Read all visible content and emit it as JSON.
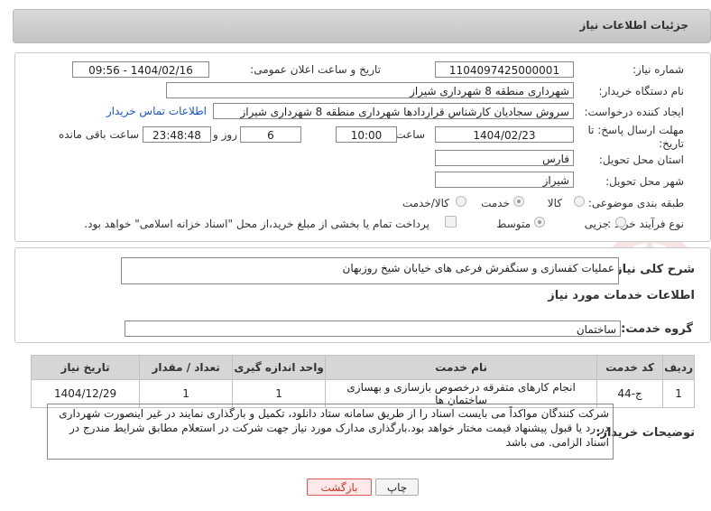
{
  "header": {
    "title": "جزئیات اطلاعات نیاز"
  },
  "form": {
    "need_number_label": "شماره نیاز:",
    "need_number": "1104097425000001",
    "announce_label": "تاریخ و ساعت اعلان عمومی:",
    "announce_value": "1404/02/16 - 09:56",
    "buyer_label": "نام دستگاه خریدار:",
    "buyer": "شهرداری منطقه 8 شهرداری شیراز",
    "creator_label": "ایجاد کننده درخواست:",
    "creator": "سروش سجادیان کارشناس قراردادها شهرداری منطقه 8 شهرداری شیراز",
    "contact_link": "اطلاعات تماس خریدار",
    "deadline_label_1": "مهلت ارسال پاسخ: تا",
    "deadline_label_2": "تاریخ:",
    "deadline_date": "1404/02/23",
    "time_label": "ساعت",
    "deadline_time": "10:00",
    "days_value": "6",
    "days_label": "روز و",
    "remaining_time": "23:48:48",
    "remaining_label": "ساعت باقی مانده",
    "province_label": "استان محل تحویل:",
    "province": "فارس",
    "city_label": "شهر محل تحویل:",
    "city": "شیراز",
    "category_label": "طبقه بندی موضوعی:",
    "category_options": [
      "کالا",
      "خدمت",
      "کالا/خدمت"
    ],
    "category_selected": "خدمت",
    "process_label": "نوع فرآیند خرید :",
    "process_options": [
      "جزیی",
      "متوسط"
    ],
    "process_selected": "متوسط",
    "payment_note": "پرداخت تمام یا بخشی از مبلغ خرید،از محل \"اسناد خزانه اسلامی\" خواهد بود."
  },
  "summary": {
    "label": "شرح کلی نیاز:",
    "text": "عملیات کفسازی و سنگفرش فرعی های خیابان شیخ روزبهان"
  },
  "services": {
    "section_title": "اطلاعات خدمات مورد نیاز",
    "group_label": "گروه خدمت:",
    "group_value": "ساختمان",
    "columns": [
      "ردیف",
      "کد خدمت",
      "نام خدمت",
      "واحد اندازه گیری",
      "تعداد / مقدار",
      "تاریخ نیاز"
    ],
    "rows": [
      [
        "1",
        "ج-44",
        "انجام کارهای متفرقه درخصوص بازسازی و بهسازی ساختمان ها",
        "1",
        "1",
        "1404/12/29"
      ]
    ]
  },
  "notes": {
    "label": "توضیحات خریدار:",
    "text": "شرکت کنندگان مواکداً می بایست اسناد را از طریق سامانه ستاد دانلود، تکمیل و بارگذاری نمایند در غیر اینصورت شهرداری در رد یا قبول پیشنهاد قیمت مختار خواهد بود.بارگذاری مدارک مورد نیاز جهت شرکت در استعلام مطابق شرایط مندرج در اسناد الزامی. می باشد"
  },
  "buttons": {
    "print": "چاپ",
    "back": "بازگشت"
  },
  "colors": {
    "accent_red": "#d9534f",
    "link": "#1a56c8"
  }
}
